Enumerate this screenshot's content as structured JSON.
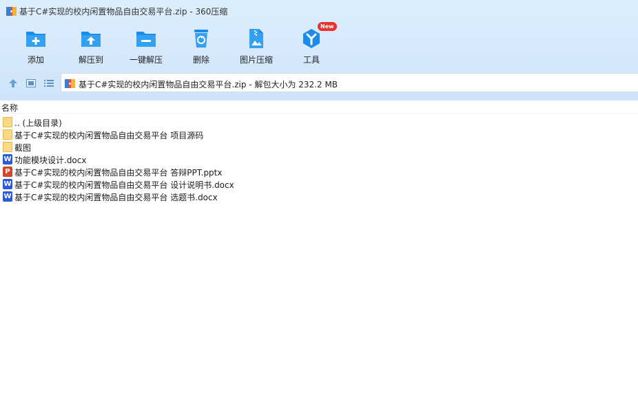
{
  "window": {
    "title": "基于C#实现的校内闲置物品自由交易平台.zip - 360压缩"
  },
  "toolbar": {
    "items": [
      {
        "label": "添加",
        "icon": "add-folder-icon"
      },
      {
        "label": "解压到",
        "icon": "extract-to-icon"
      },
      {
        "label": "一键解压",
        "icon": "one-click-extract-icon"
      },
      {
        "label": "删除",
        "icon": "delete-icon"
      },
      {
        "label": "图片压缩",
        "icon": "image-compress-icon"
      },
      {
        "label": "工具",
        "icon": "tools-icon",
        "badge": "New"
      }
    ]
  },
  "address": {
    "text": "基于C#实现的校内闲置物品自由交易平台.zip - 解包大小为 232.2 MB"
  },
  "list": {
    "header_name": "名称",
    "files": [
      {
        "name": ".. (上级目录)",
        "type": "folder"
      },
      {
        "name": "基于C#实现的校内闲置物品自由交易平台 项目源码",
        "type": "folder"
      },
      {
        "name": "截图",
        "type": "folder"
      },
      {
        "name": "功能模块设计.docx",
        "type": "word"
      },
      {
        "name": "基于C#实现的校内闲置物品自由交易平台 答辩PPT.pptx",
        "type": "ppt"
      },
      {
        "name": "基于C#实现的校内闲置物品自由交易平台 设计说明书.docx",
        "type": "word"
      },
      {
        "name": "基于C#实现的校内闲置物品自由交易平台 选题书.docx",
        "type": "word"
      }
    ]
  },
  "colors": {
    "accent_blue": "#1d8ce8",
    "word_blue": "#2b5bd7",
    "ppt_red": "#d24726",
    "folder_yellow": "#fbd983",
    "badge_red": "#e8322d"
  }
}
